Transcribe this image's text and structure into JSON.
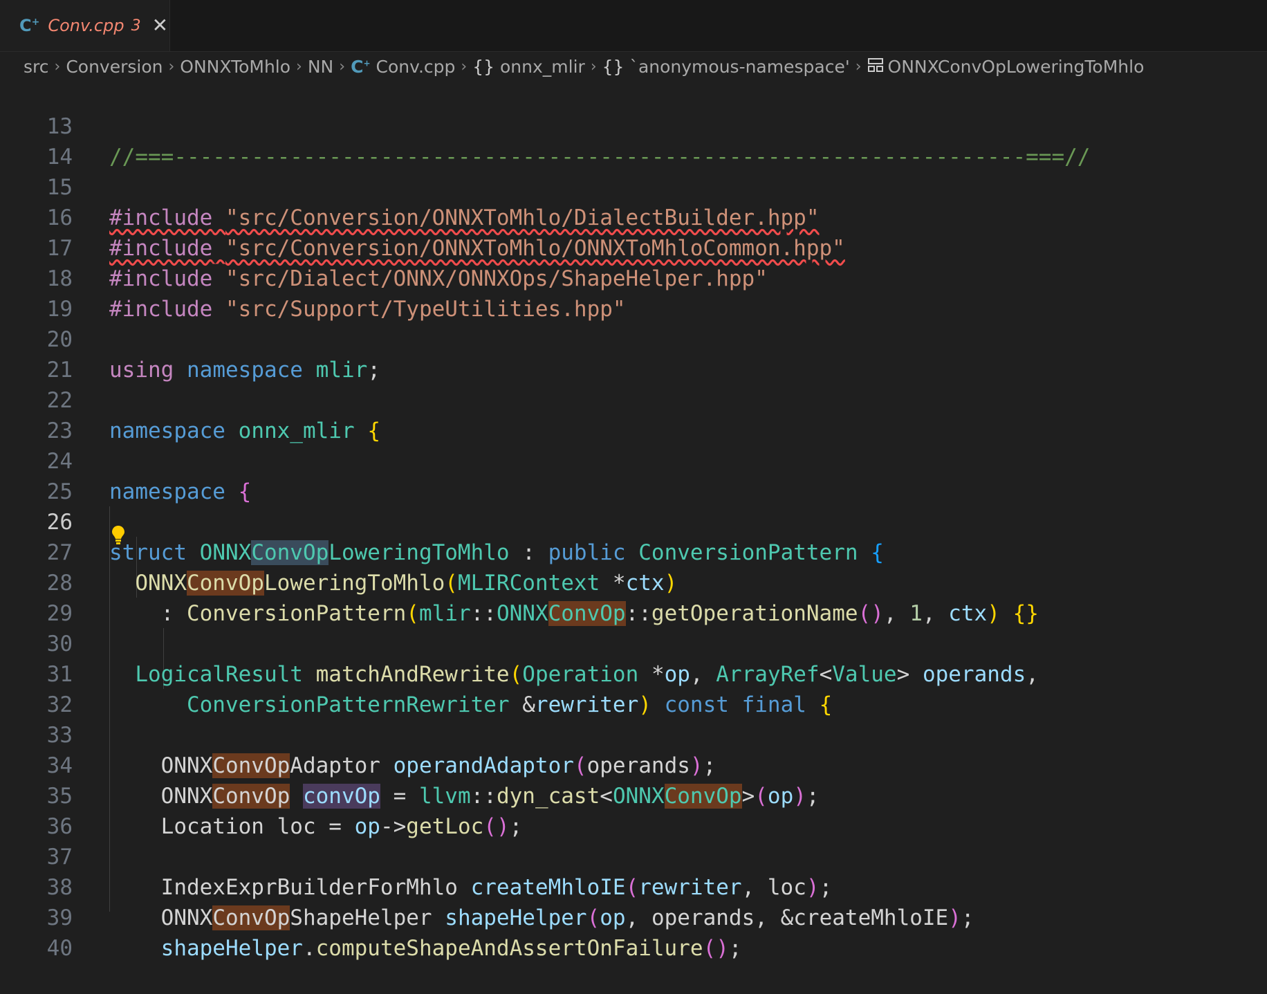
{
  "tab": {
    "icon": "cpp-file-icon",
    "filename": "Conv.cpp",
    "problem_count": "3",
    "close_label": "✕"
  },
  "breadcrumbs": {
    "items": [
      "src",
      "Conversion",
      "ONNXToMhlo",
      "NN",
      "Conv.cpp",
      "onnx_mlir",
      "`anonymous-namespace'",
      "ONNXConvOpLoweringToMhlo"
    ],
    "separator": "›",
    "brace_glyph": "{}"
  },
  "editor": {
    "lines": [
      {
        "n": "13",
        "t": "//===------------------------------------------------------------------===//"
      },
      {
        "n": "14",
        "t": ""
      },
      {
        "n": "15",
        "t": "#include \"src/Conversion/ONNXToMhlo/DialectBuilder.hpp\""
      },
      {
        "n": "16",
        "t": "#include \"src/Conversion/ONNXToMhlo/ONNXToMhloCommon.hpp\""
      },
      {
        "n": "17",
        "t": "#include \"src/Dialect/ONNX/ONNXOps/ShapeHelper.hpp\""
      },
      {
        "n": "18",
        "t": "#include \"src/Support/TypeUtilities.hpp\""
      },
      {
        "n": "19",
        "t": ""
      },
      {
        "n": "20",
        "t": "using namespace mlir;"
      },
      {
        "n": "21",
        "t": ""
      },
      {
        "n": "22",
        "t": "namespace onnx_mlir {"
      },
      {
        "n": "23",
        "t": ""
      },
      {
        "n": "24",
        "t": "namespace {"
      },
      {
        "n": "25",
        "t": ""
      },
      {
        "n": "26",
        "t": "struct ONNXConvOpLoweringToMhlo : public ConversionPattern {"
      },
      {
        "n": "27",
        "t": "  ONNXConvOpLoweringToMhlo(MLIRContext *ctx)"
      },
      {
        "n": "28",
        "t": "    : ConversionPattern(mlir::ONNXConvOp::getOperationName(), 1, ctx) {}"
      },
      {
        "n": "29",
        "t": ""
      },
      {
        "n": "30",
        "t": "  LogicalResult matchAndRewrite(Operation *op, ArrayRef<Value> operands,"
      },
      {
        "n": "31",
        "t": "      ConversionPatternRewriter &rewriter) const final {"
      },
      {
        "n": "32",
        "t": ""
      },
      {
        "n": "33",
        "t": "    ONNXConvOpAdaptor operandAdaptor(operands);"
      },
      {
        "n": "34",
        "t": "    ONNXConvOp convOp = llvm::dyn_cast<ONNXConvOp>(op);"
      },
      {
        "n": "35",
        "t": "    Location loc = op->getLoc();"
      },
      {
        "n": "36",
        "t": ""
      },
      {
        "n": "37",
        "t": "    IndexExprBuilderForMhlo createMhloIE(rewriter, loc);"
      },
      {
        "n": "38",
        "t": "    ONNXConvOpShapeHelper shapeHelper(op, operands, &createMhloIE);"
      },
      {
        "n": "39",
        "t": "    shapeHelper.computeShapeAndAssertOnFailure();"
      },
      {
        "n": "40",
        "t": ""
      }
    ],
    "active_line": "26",
    "lightbulb_icon": "lightbulb-icon"
  },
  "colors": {
    "background": "#1f1f1f",
    "tab_error": "#f48771",
    "comment": "#6a9955",
    "keyword": "#569cd6",
    "preprocessor": "#c586c0",
    "string": "#ce9178",
    "type": "#4ec9b0",
    "function": "#dcdcaa",
    "variable": "#9cdcfe",
    "occurrence_highlight": "#6b3a1e"
  }
}
